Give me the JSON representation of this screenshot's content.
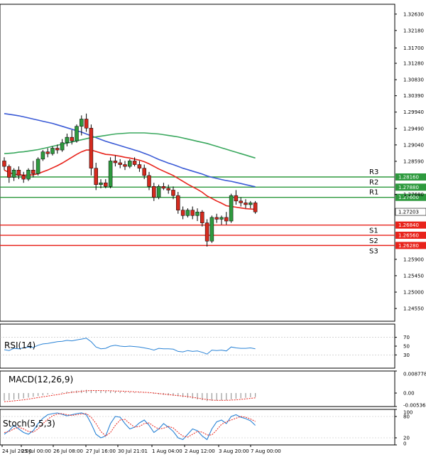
{
  "chart_data": {
    "type": "candlestick",
    "price_axis": {
      "ticks": [
        "1.32630",
        "1.32180",
        "1.31700",
        "1.31280",
        "1.30830",
        "1.30390",
        "1.29940",
        "1.29490",
        "1.29040",
        "1.28590",
        "1.28160",
        "1.27680",
        "1.27203",
        "1.26840",
        "1.26560",
        "1.26280",
        "1.25900",
        "1.25450",
        "1.25000",
        "1.24550"
      ],
      "ylim": [
        1.242,
        1.329
      ]
    },
    "time_axis": {
      "labels": [
        "24 Jul 20:00",
        "25 Jul 00:00",
        "26 Jul 08:00",
        "27 Jul 16:00",
        "30 Jul 21:01",
        "1 Aug 04:00",
        "2 Aug 12:00",
        "3 Aug 20:00",
        "7 Aug 00:00"
      ]
    },
    "levels": [
      {
        "name": "R3",
        "value": "1.28160",
        "price": 1.2816,
        "color": "#2e9a3e"
      },
      {
        "name": "R2",
        "value": "1.27880",
        "price": 1.2788,
        "color": "#2e9a3e"
      },
      {
        "name": "R1",
        "value": "1.27600",
        "price": 1.276,
        "color": "#2e9a3e"
      },
      {
        "name": "S1",
        "value": "1.26840",
        "price": 1.2684,
        "color": "#e8231b"
      },
      {
        "name": "S2",
        "value": "1.26560",
        "price": 1.2656,
        "color": "#e8231b"
      },
      {
        "name": "S3",
        "value": "1.26280",
        "price": 1.2628,
        "color": "#e8231b"
      }
    ],
    "current_price": {
      "value": "1.27203",
      "price": 1.27203
    },
    "candles": [
      [
        1.286,
        1.287,
        1.2835,
        1.2845
      ],
      [
        1.2845,
        1.285,
        1.28,
        1.2815
      ],
      [
        1.2815,
        1.284,
        1.2805,
        1.2835
      ],
      [
        1.2835,
        1.2845,
        1.281,
        1.282
      ],
      [
        1.282,
        1.283,
        1.28,
        1.281
      ],
      [
        1.281,
        1.284,
        1.2805,
        1.2835
      ],
      [
        1.2835,
        1.286,
        1.2815,
        1.2825
      ],
      [
        1.2825,
        1.287,
        1.282,
        1.2865
      ],
      [
        1.2865,
        1.289,
        1.286,
        1.2885
      ],
      [
        1.2885,
        1.2895,
        1.287,
        1.288
      ],
      [
        1.288,
        1.29,
        1.2875,
        1.2895
      ],
      [
        1.2895,
        1.2905,
        1.288,
        1.289
      ],
      [
        1.289,
        1.292,
        1.2885,
        1.291
      ],
      [
        1.291,
        1.2935,
        1.29,
        1.2925
      ],
      [
        1.2925,
        1.2945,
        1.2905,
        1.2915
      ],
      [
        1.2915,
        1.296,
        1.291,
        1.2955
      ],
      [
        1.2955,
        1.2985,
        1.293,
        1.2975
      ],
      [
        1.2975,
        1.299,
        1.294,
        1.295
      ],
      [
        1.295,
        1.296,
        1.282,
        1.284
      ],
      [
        1.284,
        1.2855,
        1.278,
        1.2795
      ],
      [
        1.2795,
        1.281,
        1.2785,
        1.28
      ],
      [
        1.28,
        1.281,
        1.2785,
        1.279
      ],
      [
        1.279,
        1.287,
        1.2785,
        1.286
      ],
      [
        1.286,
        1.2875,
        1.2845,
        1.2855
      ],
      [
        1.2855,
        1.2865,
        1.284,
        1.285
      ],
      [
        1.285,
        1.286,
        1.2835,
        1.2845
      ],
      [
        1.2845,
        1.2865,
        1.284,
        1.286
      ],
      [
        1.286,
        1.287,
        1.2845,
        1.285
      ],
      [
        1.285,
        1.286,
        1.283,
        1.284
      ],
      [
        1.284,
        1.285,
        1.281,
        1.282
      ],
      [
        1.282,
        1.283,
        1.278,
        1.279
      ],
      [
        1.279,
        1.28,
        1.275,
        1.276
      ],
      [
        1.276,
        1.2795,
        1.2755,
        1.279
      ],
      [
        1.279,
        1.28,
        1.278,
        1.2785
      ],
      [
        1.2785,
        1.2795,
        1.277,
        1.278
      ],
      [
        1.278,
        1.279,
        1.2755,
        1.2765
      ],
      [
        1.2765,
        1.2775,
        1.2715,
        1.2725
      ],
      [
        1.2725,
        1.2735,
        1.27,
        1.271
      ],
      [
        1.271,
        1.273,
        1.2705,
        1.2725
      ],
      [
        1.2725,
        1.2735,
        1.27,
        1.271
      ],
      [
        1.271,
        1.273,
        1.2695,
        1.272
      ],
      [
        1.272,
        1.2725,
        1.268,
        1.269
      ],
      [
        1.269,
        1.27,
        1.2625,
        1.264
      ],
      [
        1.264,
        1.271,
        1.2635,
        1.2705
      ],
      [
        1.2705,
        1.2715,
        1.269,
        1.27
      ],
      [
        1.27,
        1.271,
        1.2685,
        1.2705
      ],
      [
        1.2705,
        1.272,
        1.2685,
        1.2695
      ],
      [
        1.2695,
        1.277,
        1.269,
        1.2765
      ],
      [
        1.2765,
        1.278,
        1.274,
        1.275
      ],
      [
        1.275,
        1.276,
        1.2735,
        1.2745
      ],
      [
        1.2745,
        1.2755,
        1.273,
        1.274
      ],
      [
        1.274,
        1.275,
        1.273,
        1.2745
      ],
      [
        1.2745,
        1.275,
        1.2715,
        1.272
      ]
    ],
    "moving_averages": [
      {
        "color": "#e8231b",
        "values": [
          1.2835,
          1.2828,
          1.2824,
          1.2822,
          1.2821,
          1.2821,
          1.2822,
          1.2825,
          1.283,
          1.2835,
          1.2841,
          1.2847,
          1.2854,
          1.2862,
          1.287,
          1.2878,
          1.2885,
          1.289,
          1.289,
          1.2886,
          1.2882,
          1.2878,
          1.2877,
          1.2875,
          1.2873,
          1.287,
          1.2868,
          1.2865,
          1.2862,
          1.2858,
          1.2852,
          1.2845,
          1.2838,
          1.2832,
          1.2826,
          1.282,
          1.2812,
          1.2804,
          1.2796,
          1.2789,
          1.2782,
          1.2774,
          1.2764,
          1.2757,
          1.275,
          1.2744,
          1.2737,
          1.2735,
          1.2733,
          1.2731,
          1.2729,
          1.2728,
          1.2727
        ]
      },
      {
        "color": "#3b5bd6",
        "values": [
          1.299,
          1.2988,
          1.2986,
          1.2984,
          1.2981,
          1.2978,
          1.2975,
          1.2972,
          1.2969,
          1.2966,
          1.2963,
          1.2959,
          1.2955,
          1.2951,
          1.2947,
          1.2943,
          1.2939,
          1.2934,
          1.2929,
          1.2924,
          1.2919,
          1.2914,
          1.291,
          1.2906,
          1.2902,
          1.2898,
          1.2894,
          1.289,
          1.2886,
          1.2881,
          1.2876,
          1.287,
          1.2864,
          1.2859,
          1.2854,
          1.285,
          1.2845,
          1.284,
          1.2836,
          1.2832,
          1.2828,
          1.2824,
          1.2819,
          1.2815,
          1.2812,
          1.2809,
          1.2806,
          1.2804,
          1.2801,
          1.2798,
          1.2795,
          1.2792,
          1.2789
        ]
      },
      {
        "color": "#3aa85e",
        "values": [
          1.288,
          1.2881,
          1.2882,
          1.2884,
          1.2885,
          1.2887,
          1.2889,
          1.2891,
          1.2894,
          1.2897,
          1.29,
          1.2903,
          1.2906,
          1.2909,
          1.2912,
          1.2915,
          1.2918,
          1.2921,
          1.2924,
          1.2926,
          1.2928,
          1.293,
          1.2932,
          1.2934,
          1.2935,
          1.2936,
          1.2937,
          1.2937,
          1.2937,
          1.2937,
          1.2936,
          1.2935,
          1.2934,
          1.2932,
          1.293,
          1.2928,
          1.2926,
          1.2923,
          1.292,
          1.2917,
          1.2914,
          1.2911,
          1.2908,
          1.2904,
          1.29,
          1.2896,
          1.2892,
          1.2888,
          1.2884,
          1.288,
          1.2876,
          1.2872,
          1.2868
        ]
      }
    ],
    "rsi": {
      "label": "RSI(14)",
      "ticks": [
        "70",
        "50",
        "30"
      ],
      "ylim": [
        0,
        100
      ],
      "color": "#2a83d6",
      "values": [
        42,
        40,
        45,
        44,
        46,
        48,
        47,
        52,
        55,
        56,
        58,
        60,
        61,
        63,
        62,
        64,
        66,
        68,
        60,
        48,
        44,
        45,
        50,
        52,
        50,
        49,
        50,
        49,
        48,
        46,
        44,
        41,
        45,
        44,
        44,
        43,
        38,
        37,
        40,
        38,
        39,
        36,
        32,
        41,
        40,
        41,
        39,
        48,
        46,
        45,
        45,
        46,
        44
      ]
    },
    "macd": {
      "label": "MACD(12,26,9)",
      "ticks": [
        "0.008778",
        "0.00",
        "-0.005366"
      ],
      "ylim": [
        -0.005366,
        0.008778
      ],
      "hist": [
        -0.003,
        -0.0028,
        -0.0026,
        -0.0024,
        -0.0021,
        -0.0018,
        -0.0015,
        -0.0012,
        -0.0009,
        -0.0006,
        -0.0003,
        0.0,
        0.0003,
        0.0006,
        0.0008,
        0.001,
        0.0012,
        0.0013,
        0.0012,
        0.001,
        0.0009,
        0.0008,
        0.0008,
        0.0007,
        0.0006,
        0.0005,
        0.0004,
        0.0003,
        0.0002,
        0.0001,
        -0.0001,
        -0.0003,
        -0.0005,
        -0.0007,
        -0.0009,
        -0.0011,
        -0.0013,
        -0.0016,
        -0.0019,
        -0.0022,
        -0.0025,
        -0.0028,
        -0.0032,
        -0.0031,
        -0.003,
        -0.0029,
        -0.0028,
        -0.0025,
        -0.0023,
        -0.0021,
        -0.0019,
        -0.0017,
        -0.0016
      ],
      "signal": [
        -0.0034,
        -0.0033,
        -0.0031,
        -0.0029,
        -0.0027,
        -0.0024,
        -0.0021,
        -0.0018,
        -0.0015,
        -0.0012,
        -0.0009,
        -0.0006,
        -0.0003,
        0.0,
        0.0003,
        0.0005,
        0.0007,
        0.0009,
        0.001,
        0.001,
        0.001,
        0.0009,
        0.0009,
        0.0008,
        0.0008,
        0.0007,
        0.0006,
        0.0005,
        0.0004,
        0.0003,
        0.0002,
        0.0,
        -0.0002,
        -0.0004,
        -0.0006,
        -0.0008,
        -0.001,
        -0.0012,
        -0.0014,
        -0.0017,
        -0.002,
        -0.0023,
        -0.0026,
        -0.0028,
        -0.0029,
        -0.0029,
        -0.0029,
        -0.0028,
        -0.0027,
        -0.0025,
        -0.0023,
        -0.0021,
        -0.0019
      ],
      "signal_color": "#e8231b"
    },
    "stoch": {
      "label": "Stoch(5,5,3)",
      "ticks": [
        "100",
        "80",
        "20",
        "0"
      ],
      "ylim": [
        0,
        100
      ],
      "k_color": "#2a83d6",
      "d_color": "#e8231b",
      "k": [
        30,
        40,
        55,
        45,
        35,
        30,
        40,
        60,
        75,
        85,
        88,
        90,
        86,
        82,
        85,
        88,
        90,
        85,
        60,
        30,
        20,
        25,
        60,
        80,
        78,
        60,
        45,
        50,
        62,
        70,
        55,
        35,
        45,
        60,
        50,
        38,
        20,
        15,
        30,
        45,
        40,
        25,
        15,
        45,
        65,
        70,
        60,
        80,
        85,
        78,
        74,
        68,
        55
      ],
      "d": [
        35,
        38,
        45,
        50,
        45,
        38,
        36,
        45,
        60,
        72,
        82,
        87,
        88,
        85,
        83,
        85,
        87,
        88,
        78,
        60,
        38,
        25,
        35,
        55,
        70,
        72,
        60,
        50,
        52,
        60,
        62,
        52,
        45,
        47,
        52,
        48,
        35,
        25,
        22,
        30,
        38,
        36,
        28,
        28,
        42,
        58,
        65,
        70,
        75,
        80,
        78,
        73,
        66
      ]
    }
  }
}
